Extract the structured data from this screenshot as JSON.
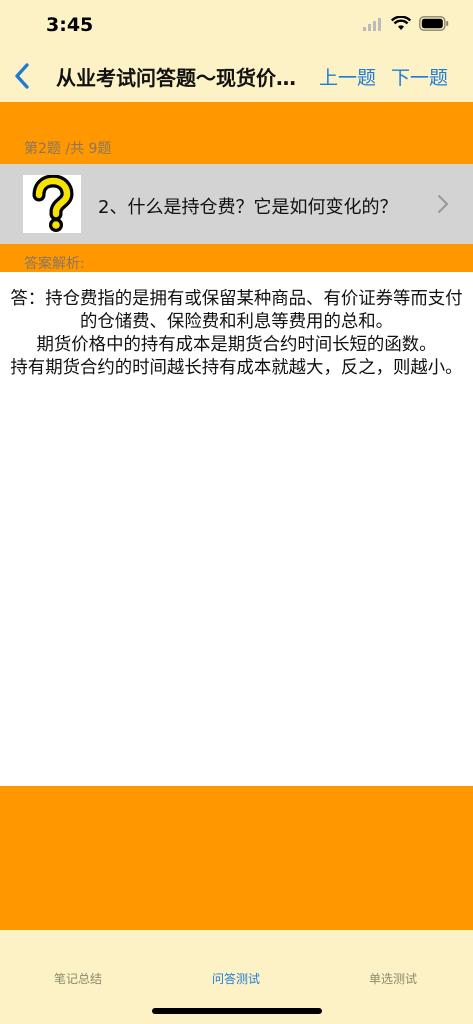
{
  "status_bar": {
    "time": "3:45"
  },
  "nav": {
    "title": "从业考试问答题～现货价…",
    "prev_label": "上一题",
    "next_label": "下一题"
  },
  "question": {
    "counter": "第2题 /共 9题",
    "text": "2、什么是持仓费？它是如何变化的？"
  },
  "answer": {
    "label": "答案解析:",
    "lines": [
      "答：持仓费指的是拥有或保留某种商品、有价证券等而支付的仓储费、保险费和利息等费用的总和。",
      "期货价格中的持有成本是期货合约时间长短的函数。",
      "持有期货合约的时间越长持有成本就越大，反之，则越小。"
    ]
  },
  "tabs": [
    {
      "label": "笔记总结",
      "active": false
    },
    {
      "label": "问答测试",
      "active": true
    },
    {
      "label": "单选测试",
      "active": false
    }
  ],
  "colors": {
    "accent": "#fe9700",
    "bar_background": "#fdf2c6",
    "link": "#1e7cd6",
    "question_row": "#d3d3d3"
  }
}
